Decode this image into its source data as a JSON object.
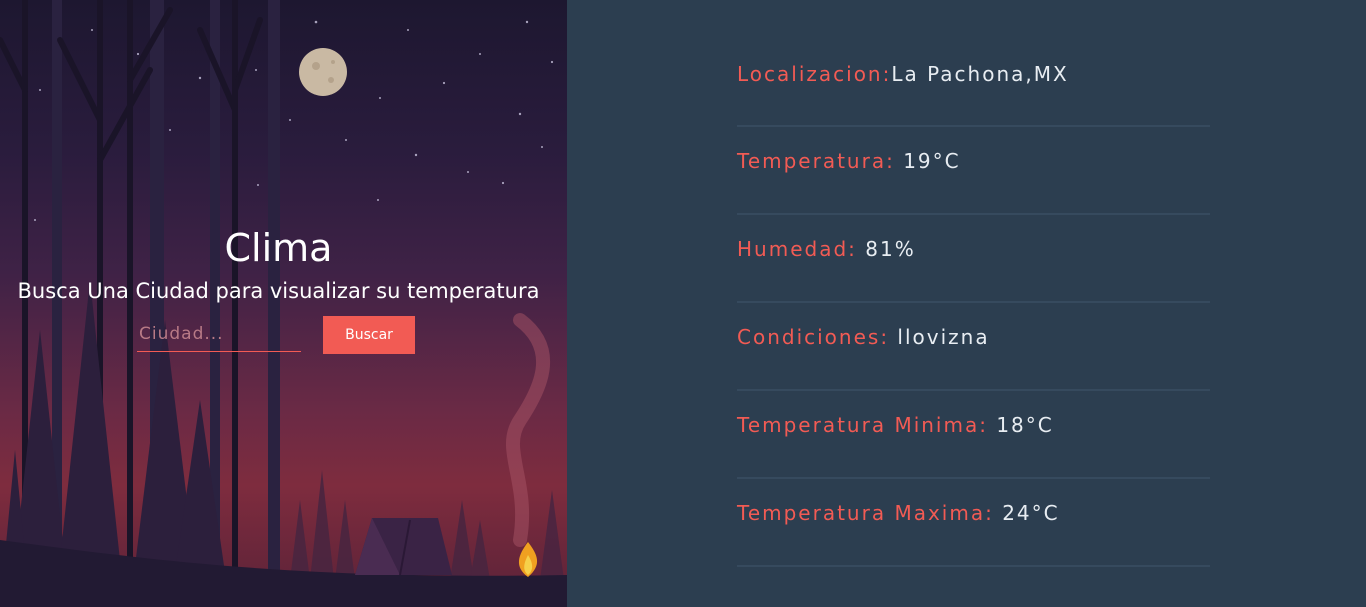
{
  "app": {
    "title": "Clima",
    "subtitle": "Busca Una Ciudad para visualizar su temperatura"
  },
  "search": {
    "placeholder": "Ciudad...",
    "value": "",
    "button_label": "Buscar"
  },
  "weather": [
    {
      "label": "Localizacion:",
      "value": "La Pachona,MX"
    },
    {
      "label": "Temperatura: ",
      "value": "19°C"
    },
    {
      "label": "Humedad: ",
      "value": "81%"
    },
    {
      "label": "Condiciones: ",
      "value": "llovizna"
    },
    {
      "label": "Temperatura Minima: ",
      "value": "18°C"
    },
    {
      "label": "Temperatura Maxima: ",
      "value": "24°C"
    }
  ],
  "colors": {
    "accent": "#f25b54",
    "panel_bg": "#2c3e50",
    "divider": "#364a5e",
    "text": "#e8edf2"
  },
  "icons": {
    "moon": "moon-icon",
    "campfire": "campfire-icon",
    "tent": "tent-icon"
  }
}
